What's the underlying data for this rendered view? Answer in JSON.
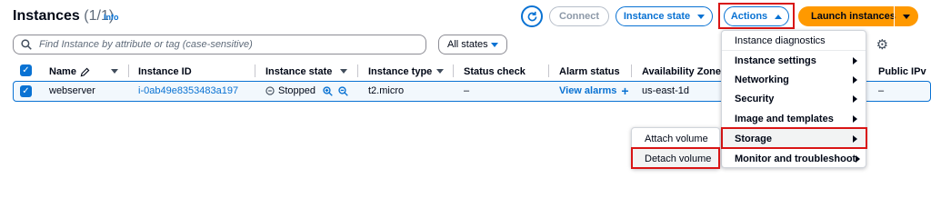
{
  "header": {
    "title": "Instances",
    "count": "(1/1)",
    "info": "Info"
  },
  "toolbar": {
    "connect": "Connect",
    "instance_state": "Instance state",
    "actions": "Actions",
    "launch": "Launch instances"
  },
  "search": {
    "placeholder": "Find Instance by attribute or tag (case-sensitive)"
  },
  "filter": {
    "states": "All states"
  },
  "table": {
    "columns": [
      "Name",
      "Instance ID",
      "Instance state",
      "Instance type",
      "Status check",
      "Alarm status",
      "Availability Zone",
      "Public IPv"
    ],
    "row": {
      "name": "webserver",
      "instance_id": "i-0ab49e8353483a197",
      "state": "Stopped",
      "type": "t2.micro",
      "status_check": "–",
      "alarm": "View alarms",
      "az": "us-east-1d",
      "public_ip": "–"
    }
  },
  "actions_menu": {
    "items": [
      "Instance diagnostics",
      "Instance settings",
      "Networking",
      "Security",
      "Image and templates",
      "Storage",
      "Monitor and troubleshoot"
    ]
  },
  "storage_menu": {
    "items": [
      "Attach volume",
      "Detach volume"
    ]
  },
  "colors": {
    "accent": "#0972d3",
    "launch": "#ff9900",
    "highlight": "#d91515"
  }
}
